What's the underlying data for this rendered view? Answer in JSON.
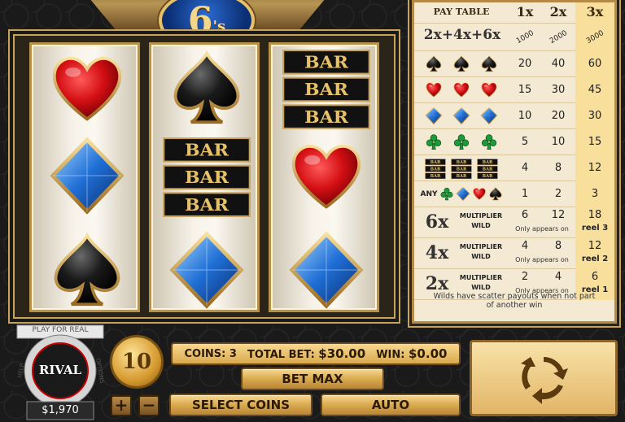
{
  "logo": {
    "number": "6",
    "suffix": "'s"
  },
  "reels": [
    [
      "heart",
      "diamond",
      "spade"
    ],
    [
      "spade",
      "bar3",
      "diamond"
    ],
    [
      "bar3",
      "heart",
      "diamond"
    ]
  ],
  "paytable": {
    "title": "PAY TABLE",
    "col_headers": [
      "1x",
      "2x",
      "3x"
    ],
    "multiplier_combo": {
      "label": "2x+4x+6x",
      "values": [
        "1000",
        "2000",
        "3000"
      ]
    },
    "rows": [
      {
        "symbol": "spade",
        "values": [
          "20",
          "40",
          "60"
        ]
      },
      {
        "symbol": "heart",
        "values": [
          "15",
          "30",
          "45"
        ]
      },
      {
        "symbol": "diamond",
        "values": [
          "10",
          "20",
          "30"
        ]
      },
      {
        "symbol": "club",
        "values": [
          "5",
          "10",
          "15"
        ]
      },
      {
        "symbol": "bar",
        "values": [
          "4",
          "8",
          "12"
        ]
      },
      {
        "symbol": "any",
        "label": "ANY",
        "values": [
          "1",
          "2",
          "3"
        ]
      }
    ],
    "wilds": [
      {
        "mult": "6x",
        "title": "MULTIPLIER WILD",
        "values": [
          "6",
          "12",
          "18"
        ],
        "note": "Only appears on",
        "reel": "reel 3"
      },
      {
        "mult": "4x",
        "title": "MULTIPLIER WILD",
        "values": [
          "4",
          "8",
          "12"
        ],
        "note": "Only appears on",
        "reel": "reel 2"
      },
      {
        "mult": "2x",
        "title": "MULTIPLIER WILD",
        "values": [
          "2",
          "4",
          "6"
        ],
        "note": "Only appears on",
        "reel": "reel 1"
      }
    ],
    "footer": "Wilds have scatter payouts when not part of another win"
  },
  "controls": {
    "play_for_real": "PLAY FOR REAL",
    "brand": "RIVAL",
    "help": "HELP",
    "options": "OPTIONS",
    "balance": "$1,970",
    "coin_value": "10",
    "coins_label": "COINS:",
    "coins_value": "3",
    "total_bet_label": "TOTAL BET:",
    "total_bet_value": "$30.00",
    "win_label": "WIN:",
    "win_value": "$0.00",
    "bet_max": "BET MAX",
    "select_coins": "SELECT COINS",
    "auto": "AUTO",
    "plus": "+",
    "minus": "−"
  },
  "colors": {
    "gold": "#d9a94f",
    "heart_red": "#d40f14",
    "diamond_blue": "#1f6fd6",
    "club_green": "#1f9a3a",
    "spade_black": "#111111"
  }
}
